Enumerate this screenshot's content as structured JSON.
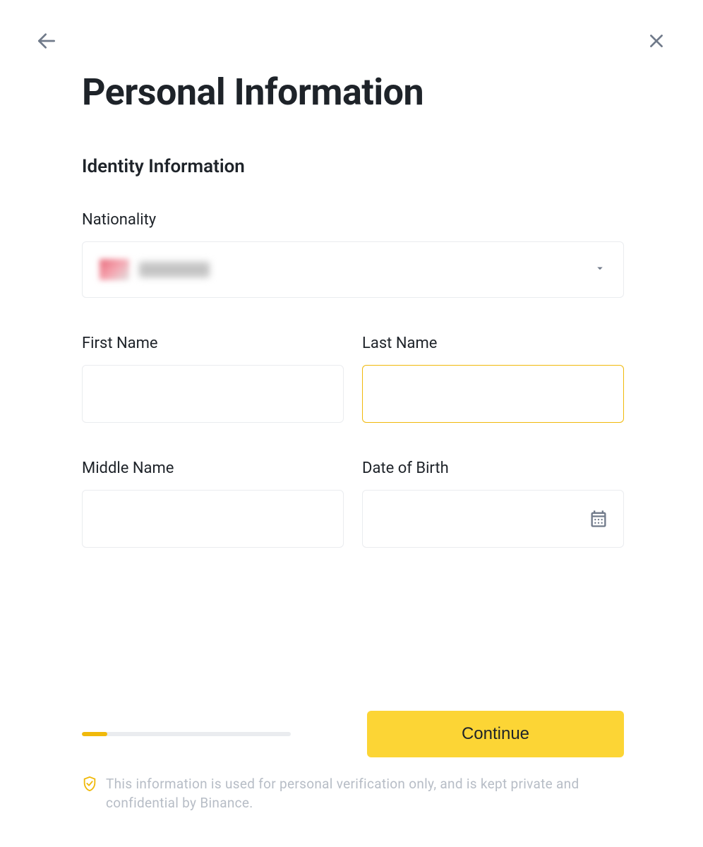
{
  "header": {
    "title": "Personal Information"
  },
  "section": {
    "title": "Identity Information"
  },
  "fields": {
    "nationality": {
      "label": "Nationality",
      "value": ""
    },
    "first_name": {
      "label": "First Name",
      "value": ""
    },
    "last_name": {
      "label": "Last Name",
      "value": ""
    },
    "middle_name": {
      "label": "Middle Name",
      "value": ""
    },
    "dob": {
      "label": "Date of Birth",
      "value": ""
    }
  },
  "progress": {
    "percent": 12
  },
  "actions": {
    "continue_label": "Continue"
  },
  "disclaimer": {
    "text": "This information is used for personal verification only, and is kept private and confidential by Binance."
  },
  "colors": {
    "accent": "#f0b90b",
    "button": "#fcd535",
    "border": "#eaecef",
    "text": "#1e2329",
    "muted": "#b7bdc6"
  }
}
